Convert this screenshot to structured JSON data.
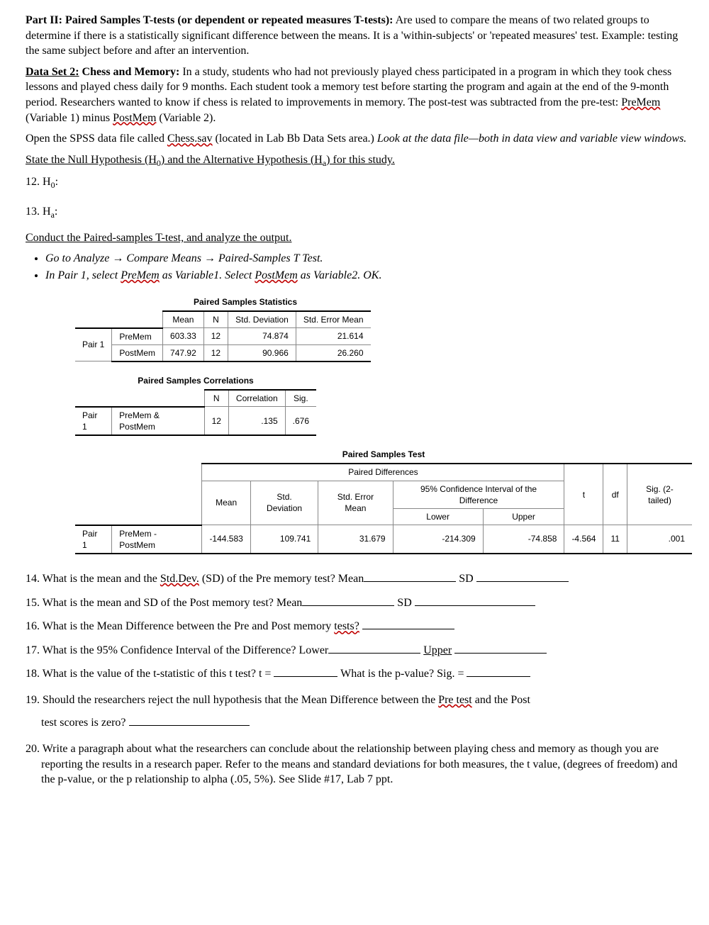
{
  "intro": {
    "part_label": "Part II: Paired Samples T-tests (or dependent or repeated measures T-tests):",
    "part_text": " Are used to compare the means of two related groups to determine if there is a statistically significant difference between the means.  It is a 'within-subjects' or 'repeated measures' test. Example: testing the same subject before and after an intervention."
  },
  "dataset": {
    "label": "Data Set 2:",
    "title": " Chess and Memory:",
    "body1": " In a study, students who had not previously played chess participated in a program in which they took chess lessons and played chess daily for 9 months.  Each student took a memory test before starting the program and again at the end of the 9-month period. Researchers wanted to know if chess is related to improvements in memory.  The post-test was subtracted from the pre-test: ",
    "var1": "PreMem",
    "mid1": " (Variable 1) minus ",
    "var2": "PostMem",
    "tail1": " (Variable 2)."
  },
  "openfile": {
    "lead": "Open the SPSS data file called ",
    "filename": "Chess.sav",
    "tail": " (located in Lab Bb Data Sets area.) ",
    "italic": "Look at the data file—both in data view and variable view windows."
  },
  "hyp": {
    "state_line": "State the Null Hypothesis (H",
    "sub0": "0",
    "mid": ") and the Alternative Hypothesis (H",
    "suba": "a",
    "end": ") for this study.",
    "h0_label": "12. H",
    "h0_sub": "0",
    "h0_colon": ":",
    "ha_label": "13. H",
    "ha_sub": "a",
    "ha_colon": ":"
  },
  "conduct": {
    "heading": "Conduct the Paired-samples T-test, and analyze the output.",
    "b1_pre": "Go to Analyze ",
    "b1_a1": "→",
    "b1_m1": " Compare Means ",
    "b1_a2": "→",
    "b1_m2": " Paired-Samples T Test.",
    "b2_pre": "In Pair 1, select ",
    "b2_v1": "PreMem",
    "b2_mid": " as Variable1. Select ",
    "b2_v2": "PostMem",
    "b2_tail": " as Variable2.  OK."
  },
  "tables": {
    "stats": {
      "title": "Paired Samples Statistics",
      "cols": {
        "mean": "Mean",
        "n": "N",
        "sd": "Std. Deviation",
        "sem": "Std. Error Mean"
      },
      "pair_label": "Pair 1",
      "rows": [
        {
          "name": "PreMem",
          "mean": "603.33",
          "n": "12",
          "sd": "74.874",
          "sem": "21.614"
        },
        {
          "name": "PostMem",
          "mean": "747.92",
          "n": "12",
          "sd": "90.966",
          "sem": "26.260"
        }
      ]
    },
    "corr": {
      "title": "Paired Samples Correlations",
      "cols": {
        "n": "N",
        "corr": "Correlation",
        "sig": "Sig."
      },
      "pair_label": "Pair 1",
      "rowname": "PreMem & PostMem",
      "n": "12",
      "corr": ".135",
      "sig": ".676"
    },
    "test": {
      "title": "Paired Samples Test",
      "group1": "Paired Differences",
      "group2": "95% Confidence Interval of the Difference",
      "cols": {
        "mean": "Mean",
        "sd": "Std. Deviation",
        "sem": "Std. Error Mean",
        "lower": "Lower",
        "upper": "Upper",
        "t": "t",
        "df": "df",
        "sig": "Sig. (2-tailed)"
      },
      "pair_label": "Pair 1",
      "rowname": "PreMem - PostMem",
      "mean": "-144.583",
      "sd": "109.741",
      "sem": "31.679",
      "lower": "-214.309",
      "upper": "-74.858",
      "t": "-4.564",
      "df": "11",
      "sig": ".001"
    }
  },
  "questions": {
    "q14a": "14. What is the mean and the ",
    "q14_sd": "Std.Dev.",
    "q14b": " (SD) of the Pre memory test?  Mean",
    "q14c": " SD ",
    "q15a": "15. What is the mean and SD of the Post memory test?  Mean",
    "q15b": " SD ",
    "q16a": "16. What is the Mean Difference between the Pre and Post memory ",
    "q16_tests": "tests?",
    "q17a": "17. What is the 95% Confidence Interval of the Difference?  Lower",
    "q17_upper": "Upper",
    "q18a": "18. What is the value of the t-statistic of this t test?  t = ",
    "q18b": " What is the p-value? Sig. = ",
    "q19a": "19. Should the researchers reject the null hypothesis that the Mean Difference between the ",
    "q19_pre": "Pre test",
    "q19b": " and the Post",
    "q19c": "test scores is zero? ",
    "q20": "20. Write a paragraph about what the researchers can conclude about the relationship between playing chess and memory as though you are reporting the results in a research paper. Refer to the means and standard deviations for both measures, the t value, (degrees of freedom) and the p-value, or the p relationship to alpha (.05, 5%). See Slide #17, Lab 7 ppt."
  }
}
